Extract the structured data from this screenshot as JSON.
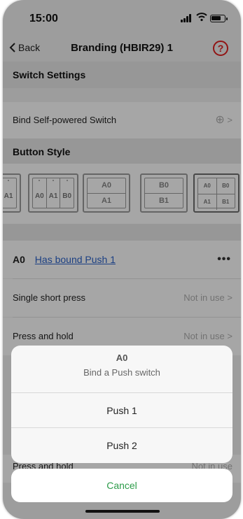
{
  "status": {
    "time": "15:00"
  },
  "nav": {
    "back_label": "Back",
    "title": "Branding (HBIR29) 1",
    "help_glyph": "?"
  },
  "switch_settings": {
    "header": "Switch Settings",
    "bind_row_label": "Bind Self-powered Switch",
    "add_glyph": "⊕",
    "chevron": ">"
  },
  "button_style": {
    "header": "Button Style",
    "option1": {
      "labels": [
        "A1"
      ]
    },
    "option2": {
      "labels": [
        "A0",
        "A1",
        "B0"
      ]
    },
    "option3": {
      "labels": [
        "A0",
        "A1"
      ]
    },
    "option4": {
      "labels": [
        "B0",
        "B1"
      ]
    },
    "option5": {
      "labels": [
        "A0",
        "B0",
        "A1",
        "B1"
      ]
    }
  },
  "a0": {
    "label": "A0",
    "link": "Has bound Push 1",
    "more": "•••",
    "rows": [
      {
        "label": "Single short press",
        "value": "Not in use",
        "chevron": ">"
      },
      {
        "label": "Press and hold",
        "value": "Not in use",
        "chevron": ">"
      },
      {
        "label": "Press and hold",
        "value": "Not in use"
      }
    ]
  },
  "action_sheet": {
    "title": "A0",
    "subtitle": "Bind a Push switch",
    "options": [
      "Push 1",
      "Push 2"
    ],
    "cancel": "Cancel"
  },
  "colors": {
    "accent_red": "#e02020",
    "link_blue": "#2a62c9",
    "cancel_green": "#2d9c4a"
  }
}
